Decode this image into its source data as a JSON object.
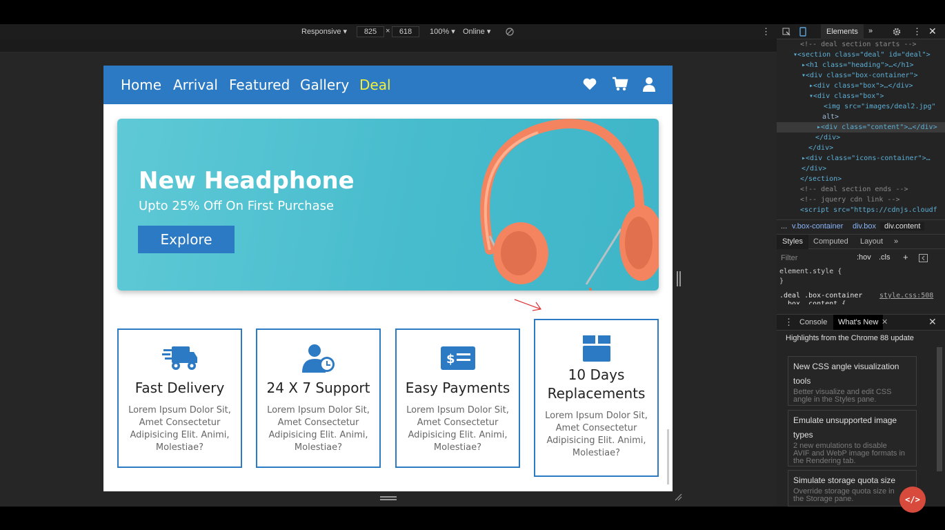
{
  "devtools_bar": {
    "device": "Responsive ▾",
    "width": "825",
    "times": "×",
    "height": "618",
    "zoom": "100% ▾",
    "network": "Online ▾"
  },
  "site": {
    "nav": {
      "links": [
        "Home",
        "Arrival",
        "Featured",
        "Gallery",
        "Deal"
      ],
      "active": "Deal",
      "icons": [
        "heart-icon",
        "cart-icon",
        "user-icon"
      ]
    },
    "banner": {
      "title": "New Headphone",
      "subtitle": "Upto 25% Off On First Purchase",
      "button": "Explore"
    },
    "features": [
      {
        "icon": "truck-icon",
        "title": "Fast Delivery",
        "text": [
          "Lorem Ipsum Dolor Sit,",
          "Amet Consectetur",
          "Adipisicing Elit. Animi,",
          "Molestiae?"
        ]
      },
      {
        "icon": "user-clock-icon",
        "title": "24 X 7 Support",
        "text": [
          "Lorem Ipsum Dolor Sit,",
          "Amet Consectetur",
          "Adipisicing Elit. Animi,",
          "Molestiae?"
        ]
      },
      {
        "icon": "money-check-icon",
        "title": "Easy Payments",
        "text": [
          "Lorem Ipsum Dolor Sit,",
          "Amet Consectetur",
          "Adipisicing Elit. Animi,",
          "Molestiae?"
        ]
      },
      {
        "icon": "box-icon",
        "title_lines": [
          "10 Days",
          "Replacements"
        ],
        "text": [
          "Lorem Ipsum Dolor Sit,",
          "Amet Consectetur",
          "Adipisicing Elit. Animi,",
          "Molestiae?"
        ]
      }
    ],
    "colors": {
      "brand": "#2c7ac4",
      "active_link": "#f6ef3a",
      "banner": "#47bccd",
      "headphone": "#f4845f"
    }
  },
  "devtools": {
    "tabs": {
      "elements": "Elements",
      "more": "»"
    },
    "code": [
      "<!-- deal section starts  -->",
      "▾<section class=\"deal\" id=\"deal\">",
      "▸<h1 class=\"heading\">…</h1>",
      "▾<div class=\"box-container\">",
      "▸<div class=\"box\">…</div>",
      "▾<div class=\"box\">",
      "<img src=\"images/deal2.jpg\"",
      "alt>",
      "▸<div class=\"content\">…</div>",
      "</div>",
      "</div>",
      "▸<div class=\"icons-container\">…",
      "</div>",
      "</section>",
      "<!-- deal section ends -->",
      "<!-- jquery cdn link  -->",
      "<script src=\"https://cdnjs.cloudf"
    ],
    "breadcrumb": [
      "...",
      "v.box-container",
      "div.box",
      "div.content"
    ],
    "style_tabs": [
      "Styles",
      "Computed",
      "Layout",
      "»"
    ],
    "filter_placeholder": "Filter",
    "filter_tools": [
      ":hov",
      ".cls",
      "+"
    ],
    "element_style": "element.style {",
    "element_style_close": "}",
    "rule_selector": ".deal .box-container",
    "rule_selector2": ".box .content {",
    "rule_source": "style.css:508",
    "drawer_tabs": [
      "Console",
      "What's New"
    ],
    "highlights": "Highlights from the Chrome 88 update",
    "cards": [
      {
        "title": [
          "New CSS angle visualization",
          "tools"
        ],
        "desc": [
          "Better visualize and edit CSS",
          "angle in the Styles pane."
        ]
      },
      {
        "title": [
          "Emulate unsupported image",
          "types"
        ],
        "desc": [
          "2 new emulations to disable",
          "AVIF and WebP image formats in",
          "the Rendering tab."
        ]
      },
      {
        "title": [
          "Simulate storage quota size"
        ],
        "desc": [
          "Override storage quota size in",
          "the Storage pane."
        ]
      }
    ]
  }
}
